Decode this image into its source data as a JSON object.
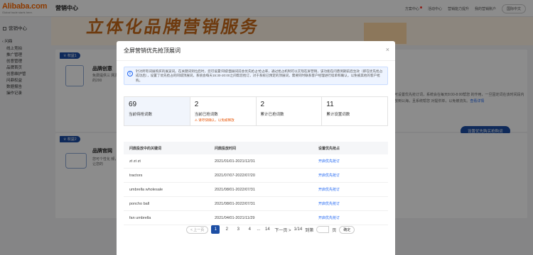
{
  "header": {
    "logo_main": "Alibaba.com",
    "logo_sub": "Global trade starts here.",
    "app_title": "营销中心",
    "links": [
      "方案中心",
      "活动中心",
      "营销能力提升",
      "我的营销账户"
    ],
    "lang": "国际中文"
  },
  "sidebar": {
    "title": "营销中心",
    "group": "问鼎",
    "items": [
      "线上竞拍",
      "推广管理",
      "创意管理",
      "品牌首页",
      "创意维护管",
      "问鼎权益",
      "数据报告",
      "操作记录"
    ]
  },
  "background": {
    "banner_text": "立体化品牌营销服务",
    "card1": {
      "badge": "权益1",
      "title": "品牌创意",
      "desc": "免费提供三 网页的200",
      "right_desc": "您可设置优先抢订词，系统会在每天8:00-8:00帮您 的作用，一旦固定词在该时间段内释放到公海，且系统帮您 对提供单，以免被流失。",
      "right_link": "查看详情",
      "button": "设置优先购买抢购词"
    },
    "card2": {
      "badge": "权益2",
      "title": "品牌官网",
      "desc": "您可个性化 频，让您的"
    }
  },
  "modal": {
    "title": "全屏营销优先抢顶展词",
    "close": "×",
    "notice": "针对所有词展购买的展览词。在关键词到位后时，您可设置'同城'面展词前会优先抢占'抢占率，通过抢占机制可以实现在屏营销，该功能在问鼎到期前后生效（即在优先抢占成功后），设置了优先抢占的同城顶展词，系统会每天15:30-20:00之间帮您抢订，对于系统已预定的顶展词，需要同时联系客户经理进行续单和确认，以免被其他的客户抢购。",
    "stats": [
      {
        "num": "69",
        "label": "当前待抢词数",
        "warn": ""
      },
      {
        "num": "2",
        "label": "当前已抢词数",
        "warn": "请尽快确认，以免被释放"
      },
      {
        "num": "2",
        "label": "累计已抢词数",
        "warn": ""
      },
      {
        "num": "11",
        "label": "累计设置词数",
        "warn": ""
      }
    ],
    "table": {
      "headers": [
        "问鼎投放中的关键词",
        "问鼎投放时间",
        "设置优先抢占"
      ],
      "rows": [
        {
          "kw": "zt zt zt",
          "time": "2021/01/01-2021/12/31",
          "action": "开启优先抢订"
        },
        {
          "kw": "tractors",
          "time": "2021/07/07-2022/07/20",
          "action": "开启优先抢订"
        },
        {
          "kw": "umbrella wholesale",
          "time": "2021/08/01-2022/07/31",
          "action": "开启优先抢订"
        },
        {
          "kw": "poncho ball",
          "time": "2021/08/01-2022/07/31",
          "action": "开启优先抢订"
        },
        {
          "kw": "fan umbrella",
          "time": "2021/04/01-2021/11/29",
          "action": "开启优先抢订"
        }
      ]
    },
    "pager": {
      "prev": "< 上一页",
      "pages": [
        "1",
        "2",
        "3",
        "4"
      ],
      "ellipsis": "...",
      "last": "14",
      "next": "下一页 >",
      "total": "1/14",
      "goto": "到第",
      "page_unit": "页",
      "ok": "确定"
    }
  },
  "colors": {
    "brand": "#ff6a00",
    "primary": "#1c4ea4",
    "link": "#1c64f2",
    "warn": "#e8590c"
  }
}
